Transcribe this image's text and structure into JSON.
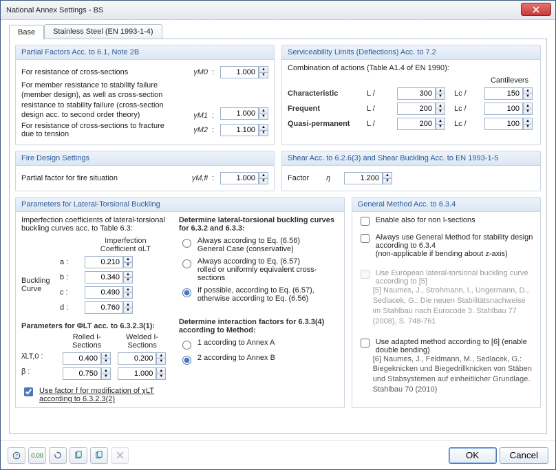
{
  "window": {
    "title": "National Annex Settings - BS"
  },
  "tabs": {
    "base": "Base",
    "stainless": "Stainless Steel (EN 1993-1-4)"
  },
  "partial": {
    "title": "Partial Factors Acc. to 6.1, Note 2B",
    "r1": "For resistance of cross-sections",
    "r1sym": "γM0",
    "r1val": "1.000",
    "r2": "For member resistance to stability failure (member design), as well as cross-section resistance to stability failure (cross-section design acc. to second order theory)",
    "r2sym": "γM1",
    "r2val": "1.000",
    "r3": "For resistance of cross-sections to fracture due to tension",
    "r3sym": "γM2",
    "r3val": "1.100"
  },
  "serv": {
    "title": "Serviceability Limits (Deflections) Acc. to 7.2",
    "combo": "Combination of actions (Table A1.4 of EN 1990):",
    "cant": "Cantilevers",
    "char": "Characteristic",
    "freq": "Frequent",
    "quasi": "Quasi-permanent",
    "L": "L /",
    "Lc": "Lc /",
    "v11": "300",
    "v12": "150",
    "v21": "200",
    "v22": "100",
    "v31": "200",
    "v32": "100"
  },
  "fire": {
    "title": "Fire Design Settings",
    "label": "Partial factor for fire situation",
    "sym": "γM,fi",
    "val": "1.000"
  },
  "shear": {
    "title": "Shear Acc. to 6.2.6(3) and Shear Buckling Acc. to EN 1993-1-5",
    "label": "Factor",
    "sym": "η",
    "val": "1.200"
  },
  "ltb": {
    "title": "Parameters for Lateral-Torsional Buckling",
    "intro": "Imperfection coefficients of lateral-torsional buckling curves acc. to Table 6.3:",
    "impHdr1": "Imperfection",
    "impHdr2": "Coefficient αLT",
    "curve": "Buckling\nCurve",
    "a": "a :",
    "b": "b :",
    "c": "c :",
    "d": "d :",
    "va": "0.210",
    "vb": "0.340",
    "vc": "0.490",
    "vd": "0.760",
    "phiTitle": "Parameters for ΦLT acc. to 6.3.2.3(1):",
    "rolled": "Rolled I-Sections",
    "welded": "Welded I-Sections",
    "lam": "λ̄LT,0 :",
    "beta": "β :",
    "lamR": "0.400",
    "lamW": "0.200",
    "betaR": "0.750",
    "betaW": "1.000",
    "usef": "Use factor f for modification of χLT according to 6.3.2.3(2)",
    "detTitle": "Determine lateral-torsional buckling curves for 6.3.2 and 6.3.3:",
    "opt1a": "Always according to Eq. (6.56)",
    "opt1b": "General Case (conservative)",
    "opt2a": "Always according to Eq. (6.57)",
    "opt2b": "rolled or uniformly equivalent cross-sections",
    "opt3": "If possible, according to Eq. (6.57), otherwise according to Eq. (6.56)",
    "intTitle": "Determine interaction factors for 6.3.3(4) according to Method:",
    "int1": "1 according to Annex A",
    "int2": "2 according to Annex B"
  },
  "gen": {
    "title": "General Method Acc. to 6.3.4",
    "c1": "Enable also for non I-sections",
    "c2": "Always use General Method for stability design according to 6.3.4",
    "c2n": "(non-applicable if bending about z-axis)",
    "c3": "Use European lateral-torsional buckling curve according to [5]",
    "c3n": "[5] Naumes, J., Strohmann, I., Ungermann, D., Sedlacek, G.: Die neuen Stabilitätsnachweise im Stahlbau nach Eurocode 3. Stahlbau 77 (2008), S. 748-761",
    "c4": "Use adapted method according to [6] (enable double bending)",
    "c4n": "[6] Naumes, J., Feldmann, M., Sedlacek, G.: Biegeknicken und Biegedrillknicken von Stäben und Stabsystemen auf einheitlicher Grundlage. Stahlbau 70 (2010)"
  },
  "buttons": {
    "ok": "OK",
    "cancel": "Cancel"
  }
}
